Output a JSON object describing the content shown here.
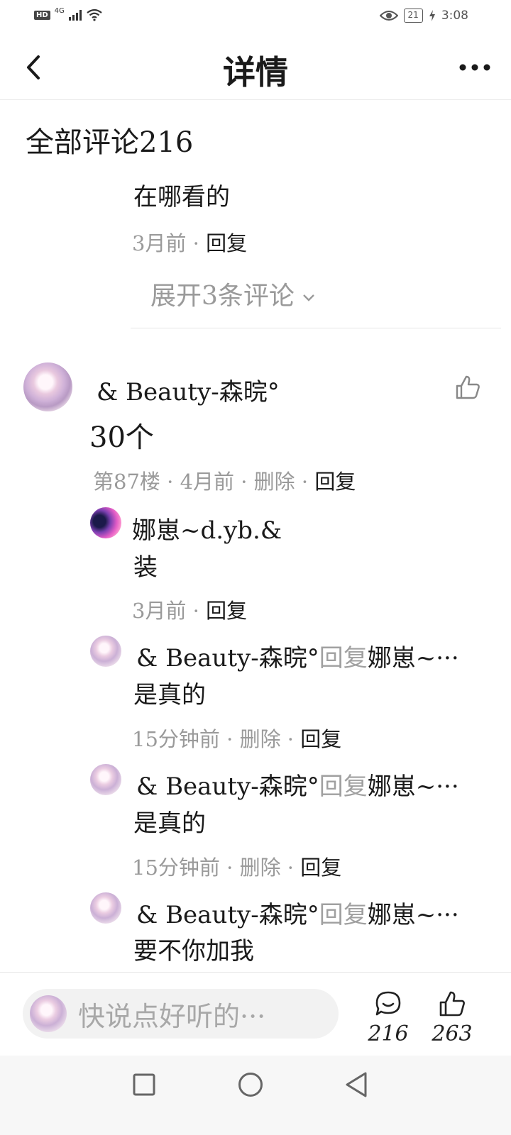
{
  "status_bar": {
    "hd": "HD",
    "network": "4G",
    "battery": "21",
    "time": "3:08",
    "left_icons": [
      "hd-badge",
      "signal-icon",
      "wifi-icon"
    ],
    "right_icons": [
      "eye-icon",
      "battery-icon",
      "charging-icon"
    ]
  },
  "header": {
    "title": "详情",
    "back_icon": "chevron-left-icon",
    "more_icon": "more-dots-icon"
  },
  "comments": {
    "title": "全部评论216",
    "prev_thread": {
      "text": "在哪看的",
      "time": "3月前",
      "sep": "·",
      "reply_label": "回复",
      "expand_label": "展开3条评论"
    },
    "main": {
      "author": "& Beauty-森晥°",
      "text": "30个",
      "floor": "第87楼",
      "time": "4月前",
      "delete_label": "删除",
      "reply_label": "回复",
      "sep": "·"
    },
    "replies": [
      {
        "author": "娜崽~d.yb.&",
        "text": "装",
        "time": "3月前",
        "reply_label": "回复",
        "sep": "·"
      },
      {
        "author": "& Beauty-森晥°",
        "reply_word": "回复",
        "target": "娜崽~···",
        "text": "是真的",
        "time": "15分钟前",
        "delete_label": "删除",
        "reply_label": "回复",
        "sep": "·"
      },
      {
        "author": "& Beauty-森晥°",
        "reply_word": "回复",
        "target": "娜崽~···",
        "text": "是真的",
        "time": "15分钟前",
        "delete_label": "删除",
        "reply_label": "回复",
        "sep": "·"
      },
      {
        "author": "& Beauty-森晥°",
        "reply_word": "回复",
        "target": "娜崽~···",
        "text": "要不你加我"
      }
    ]
  },
  "bottom_bar": {
    "input_placeholder": "快说点好听的···",
    "comment_count": "216",
    "like_count": "263"
  },
  "colors": {
    "text": "#1a1a1a",
    "muted": "#9a9a9a",
    "input_bg": "#f2f2f2",
    "divider": "#ececec"
  }
}
